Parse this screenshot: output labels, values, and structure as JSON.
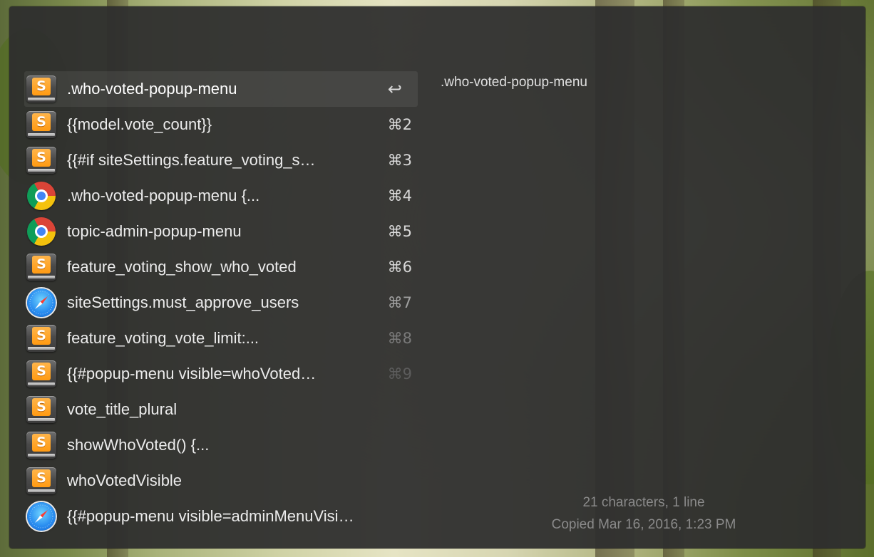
{
  "clips": [
    {
      "icon": "sublime-text-icon",
      "text": ".who-voted-popup-menu",
      "shortcut": "↩",
      "selected": true
    },
    {
      "icon": "sublime-text-icon",
      "text": "{{model.vote_count}}",
      "shortcut": "⌘2"
    },
    {
      "icon": "sublime-text-icon",
      "text": "{{#if siteSettings.feature_voting_s…",
      "shortcut": "⌘3"
    },
    {
      "icon": "chrome-icon",
      "text": ".who-voted-popup-menu {...",
      "shortcut": "⌘4"
    },
    {
      "icon": "chrome-icon",
      "text": "topic-admin-popup-menu",
      "shortcut": "⌘5"
    },
    {
      "icon": "sublime-text-icon",
      "text": "feature_voting_show_who_voted",
      "shortcut": "⌘6"
    },
    {
      "icon": "safari-icon",
      "text": "siteSettings.must_approve_users",
      "shortcut": "⌘7"
    },
    {
      "icon": "sublime-text-icon",
      "text": "feature_voting_vote_limit:...",
      "shortcut": "⌘8"
    },
    {
      "icon": "sublime-text-icon",
      "text": "{{#popup-menu visible=whoVoted…",
      "shortcut": "⌘9"
    },
    {
      "icon": "sublime-text-icon",
      "text": "vote_title_plural",
      "shortcut": ""
    },
    {
      "icon": "sublime-text-icon",
      "text": "showWhoVoted() {...",
      "shortcut": ""
    },
    {
      "icon": "sublime-text-icon",
      "text": "whoVotedVisible",
      "shortcut": ""
    },
    {
      "icon": "safari-icon",
      "text": "{{#popup-menu visible=adminMenuVisi…",
      "shortcut": ""
    }
  ],
  "preview": {
    "text": ".who-voted-popup-menu",
    "stats": "21 characters, 1 line",
    "copied": "Copied Mar 16, 2016, 1:23 PM"
  }
}
